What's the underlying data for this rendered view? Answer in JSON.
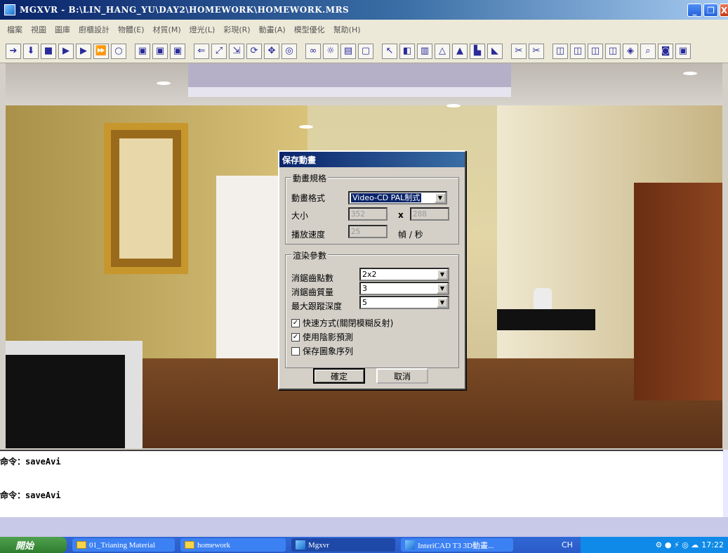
{
  "window": {
    "title": "MGXVR - B:\\LIN_HANG_YU\\DAY2\\HOMEWORK\\HOMEWORK.MRS",
    "btn_minimize": "_",
    "btn_maximize": "❐",
    "btn_close": "X"
  },
  "menu": [
    "檔案",
    "視圖",
    "圖庫",
    "廚櫃設計",
    "物體(E)",
    "材質(M)",
    "燈光(L)",
    "彩現(R)",
    "動畫(A)",
    "模型優化",
    "幫助(H)"
  ],
  "dialog": {
    "title": "保存動畫",
    "group1_label": "動畫規格",
    "format_label": "動畫格式",
    "format_value": "Video-CD PAL制式",
    "size_label": "大小",
    "width": "352",
    "height": "288",
    "x_sep": "x",
    "speed_label": "播放速度",
    "speed": "25",
    "speed_unit": "幀 / 秒",
    "group2_label": "渲染參數",
    "aa_points_label": "消鋸齒點數",
    "aa_points": "2x2",
    "aa_quality_label": "消鋸齒質量",
    "aa_quality": "3",
    "trace_depth_label": "最大跟蹤深度",
    "trace_depth": "5",
    "fast_mode_label": "快速方式(關閉模糊反射)",
    "fast_mode_checked": true,
    "shadow_pred_label": "使用陰影預測",
    "shadow_pred_checked": true,
    "save_seq_label": "保存圖象序列",
    "save_seq_checked": false,
    "ok_label": "確定",
    "cancel_label": "取消",
    "arrow": "▼",
    "check_mark": "✓"
  },
  "command": {
    "line1": "命令：saveAvi",
    "line2": "命令：saveAvi"
  },
  "taskbar": {
    "start": "開始",
    "tasks": [
      "01_Trianing Material",
      "homework",
      "Mgxvr",
      "InteriCAD T3 3D動畫..."
    ],
    "lang": "CH",
    "clock": "17:22"
  }
}
